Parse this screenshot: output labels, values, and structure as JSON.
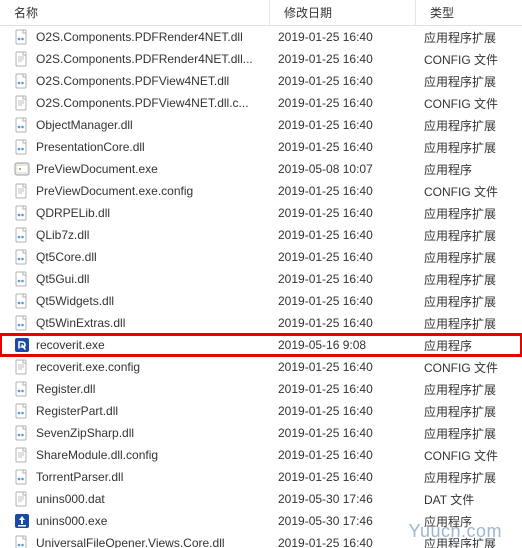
{
  "columns": {
    "name": "名称",
    "date": "修改日期",
    "type": "类型"
  },
  "icons": {
    "dll": "dll-icon",
    "config": "config-icon",
    "exe_preview": "exe-preview-icon",
    "exe_recoverit": "exe-recoverit-icon",
    "exe_uninstall": "exe-uninstall-icon",
    "dat": "dat-icon"
  },
  "rows": [
    {
      "icon": "dll",
      "name": "O2S.Components.PDFRender4NET.dll",
      "date": "2019-01-25 16:40",
      "type": "应用程序扩展",
      "hl": false
    },
    {
      "icon": "config",
      "name": "O2S.Components.PDFRender4NET.dll...",
      "date": "2019-01-25 16:40",
      "type": "CONFIG 文件",
      "hl": false
    },
    {
      "icon": "dll",
      "name": "O2S.Components.PDFView4NET.dll",
      "date": "2019-01-25 16:40",
      "type": "应用程序扩展",
      "hl": false
    },
    {
      "icon": "config",
      "name": "O2S.Components.PDFView4NET.dll.c...",
      "date": "2019-01-25 16:40",
      "type": "CONFIG 文件",
      "hl": false
    },
    {
      "icon": "dll",
      "name": "ObjectManager.dll",
      "date": "2019-01-25 16:40",
      "type": "应用程序扩展",
      "hl": false
    },
    {
      "icon": "dll",
      "name": "PresentationCore.dll",
      "date": "2019-01-25 16:40",
      "type": "应用程序扩展",
      "hl": false
    },
    {
      "icon": "exe_preview",
      "name": "PreViewDocument.exe",
      "date": "2019-05-08 10:07",
      "type": "应用程序",
      "hl": false
    },
    {
      "icon": "config",
      "name": "PreViewDocument.exe.config",
      "date": "2019-01-25 16:40",
      "type": "CONFIG 文件",
      "hl": false
    },
    {
      "icon": "dll",
      "name": "QDRPELib.dll",
      "date": "2019-01-25 16:40",
      "type": "应用程序扩展",
      "hl": false
    },
    {
      "icon": "dll",
      "name": "QLib7z.dll",
      "date": "2019-01-25 16:40",
      "type": "应用程序扩展",
      "hl": false
    },
    {
      "icon": "dll",
      "name": "Qt5Core.dll",
      "date": "2019-01-25 16:40",
      "type": "应用程序扩展",
      "hl": false
    },
    {
      "icon": "dll",
      "name": "Qt5Gui.dll",
      "date": "2019-01-25 16:40",
      "type": "应用程序扩展",
      "hl": false
    },
    {
      "icon": "dll",
      "name": "Qt5Widgets.dll",
      "date": "2019-01-25 16:40",
      "type": "应用程序扩展",
      "hl": false
    },
    {
      "icon": "dll",
      "name": "Qt5WinExtras.dll",
      "date": "2019-01-25 16:40",
      "type": "应用程序扩展",
      "hl": false
    },
    {
      "icon": "exe_recoverit",
      "name": "recoverit.exe",
      "date": "2019-05-16 9:08",
      "type": "应用程序",
      "hl": true
    },
    {
      "icon": "config",
      "name": "recoverit.exe.config",
      "date": "2019-01-25 16:40",
      "type": "CONFIG 文件",
      "hl": false
    },
    {
      "icon": "dll",
      "name": "Register.dll",
      "date": "2019-01-25 16:40",
      "type": "应用程序扩展",
      "hl": false
    },
    {
      "icon": "dll",
      "name": "RegisterPart.dll",
      "date": "2019-01-25 16:40",
      "type": "应用程序扩展",
      "hl": false
    },
    {
      "icon": "dll",
      "name": "SevenZipSharp.dll",
      "date": "2019-01-25 16:40",
      "type": "应用程序扩展",
      "hl": false
    },
    {
      "icon": "config",
      "name": "ShareModule.dll.config",
      "date": "2019-01-25 16:40",
      "type": "CONFIG 文件",
      "hl": false
    },
    {
      "icon": "dll",
      "name": "TorrentParser.dll",
      "date": "2019-01-25 16:40",
      "type": "应用程序扩展",
      "hl": false
    },
    {
      "icon": "dat",
      "name": "unins000.dat",
      "date": "2019-05-30 17:46",
      "type": "DAT 文件",
      "hl": false
    },
    {
      "icon": "exe_uninstall",
      "name": "unins000.exe",
      "date": "2019-05-30 17:46",
      "type": "应用程序",
      "hl": false
    },
    {
      "icon": "dll",
      "name": "UniversalFileOpener.Views.Core.dll",
      "date": "2019-01-25 16:40",
      "type": "应用程序扩展",
      "hl": false
    }
  ],
  "watermark": "Yuucn.com"
}
